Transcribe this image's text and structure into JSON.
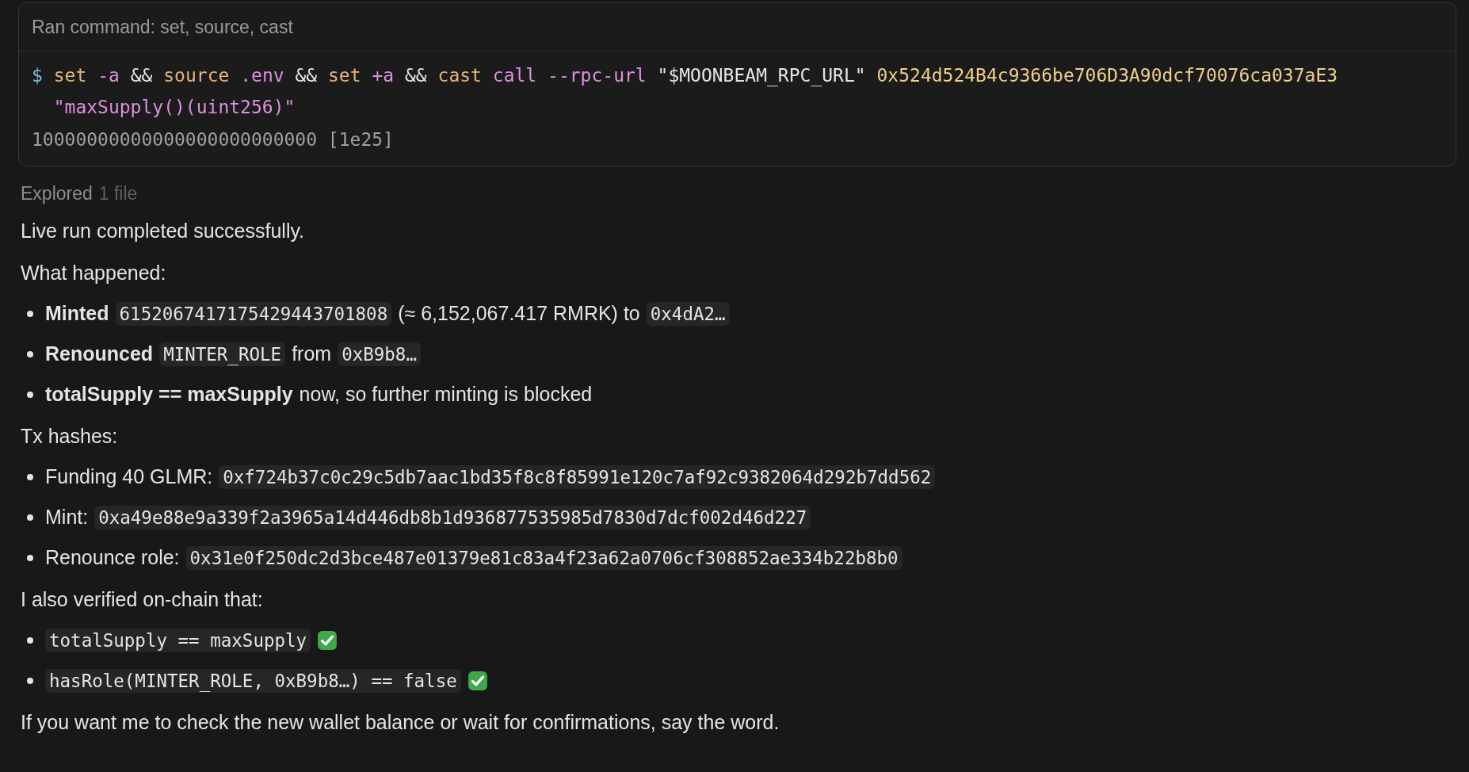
{
  "command": {
    "header": "Ran command: set, source, cast",
    "tokens": [
      {
        "text": "$",
        "kind": "prompt"
      },
      {
        "text": "set",
        "kind": "cmd"
      },
      {
        "text": "-a",
        "kind": "arg"
      },
      {
        "text": "&&",
        "kind": "op"
      },
      {
        "text": "source",
        "kind": "cmd"
      },
      {
        "text": ".env",
        "kind": "arg"
      },
      {
        "text": "&&",
        "kind": "op"
      },
      {
        "text": "set",
        "kind": "cmd"
      },
      {
        "text": "+a",
        "kind": "arg"
      },
      {
        "text": "&&",
        "kind": "op"
      },
      {
        "text": "cast",
        "kind": "cmd"
      },
      {
        "text": "call",
        "kind": "arg"
      },
      {
        "text": "--rpc-url",
        "kind": "arg"
      },
      {
        "text": "\"$MOONBEAM_RPC_URL\"",
        "kind": "op"
      },
      {
        "text": "0x524d524B4c9366be706D3A90dcf70076ca037aE3",
        "kind": "number"
      },
      {
        "text": "\"maxSupply()(uint256)\"",
        "kind": "arg"
      }
    ],
    "output": "10000000000000000000000000 [1e25]"
  },
  "explored": {
    "label": "Explored",
    "count": "1 file"
  },
  "blocks": [
    {
      "kind": "paragraph",
      "text": "Live run completed successfully."
    },
    {
      "kind": "paragraph",
      "text": "What happened:"
    },
    {
      "kind": "list",
      "items": [
        {
          "parts": [
            {
              "kind": "bold",
              "text": "Minted"
            },
            {
              "kind": "code",
              "text": "6152067417175429443701808"
            },
            {
              "kind": "text",
              "text": "(≈ 6,152,067.417 RMRK) to"
            },
            {
              "kind": "code",
              "text": "0x4dA2…"
            }
          ]
        },
        {
          "parts": [
            {
              "kind": "bold",
              "text": "Renounced"
            },
            {
              "kind": "code",
              "text": "MINTER_ROLE"
            },
            {
              "kind": "text",
              "text": "from"
            },
            {
              "kind": "code",
              "text": "0xB9b8…"
            }
          ]
        },
        {
          "parts": [
            {
              "kind": "bold",
              "text": "totalSupply == maxSupply"
            },
            {
              "kind": "text",
              "text": "now, so further minting is blocked"
            }
          ]
        }
      ]
    },
    {
      "kind": "paragraph",
      "text": "Tx hashes:"
    },
    {
      "kind": "list",
      "items": [
        {
          "parts": [
            {
              "kind": "text",
              "text": "Funding 40 GLMR:"
            },
            {
              "kind": "code",
              "text": "0xf724b37c0c29c5db7aac1bd35f8c8f85991e120c7af92c9382064d292b7dd562"
            }
          ]
        },
        {
          "parts": [
            {
              "kind": "text",
              "text": "Mint:"
            },
            {
              "kind": "code",
              "text": "0xa49e88e9a339f2a3965a14d446db8b1d936877535985d7830d7dcf002d46d227"
            }
          ]
        },
        {
          "parts": [
            {
              "kind": "text",
              "text": "Renounce role:"
            },
            {
              "kind": "code",
              "text": "0x31e0f250dc2d3bce487e01379e81c83a4f23a62a0706cf308852ae334b22b8b0"
            }
          ]
        }
      ]
    },
    {
      "kind": "paragraph",
      "text": "I also verified on-chain that:"
    },
    {
      "kind": "list",
      "items": [
        {
          "parts": [
            {
              "kind": "code",
              "text": "totalSupply == maxSupply"
            },
            {
              "kind": "check"
            }
          ]
        },
        {
          "parts": [
            {
              "kind": "code",
              "text": "hasRole(MINTER_ROLE, 0xB9b8…) == false"
            },
            {
              "kind": "check"
            }
          ]
        }
      ]
    },
    {
      "kind": "paragraph",
      "text": "If you want me to check the new wallet balance or wait for confirmations, say the word."
    }
  ]
}
